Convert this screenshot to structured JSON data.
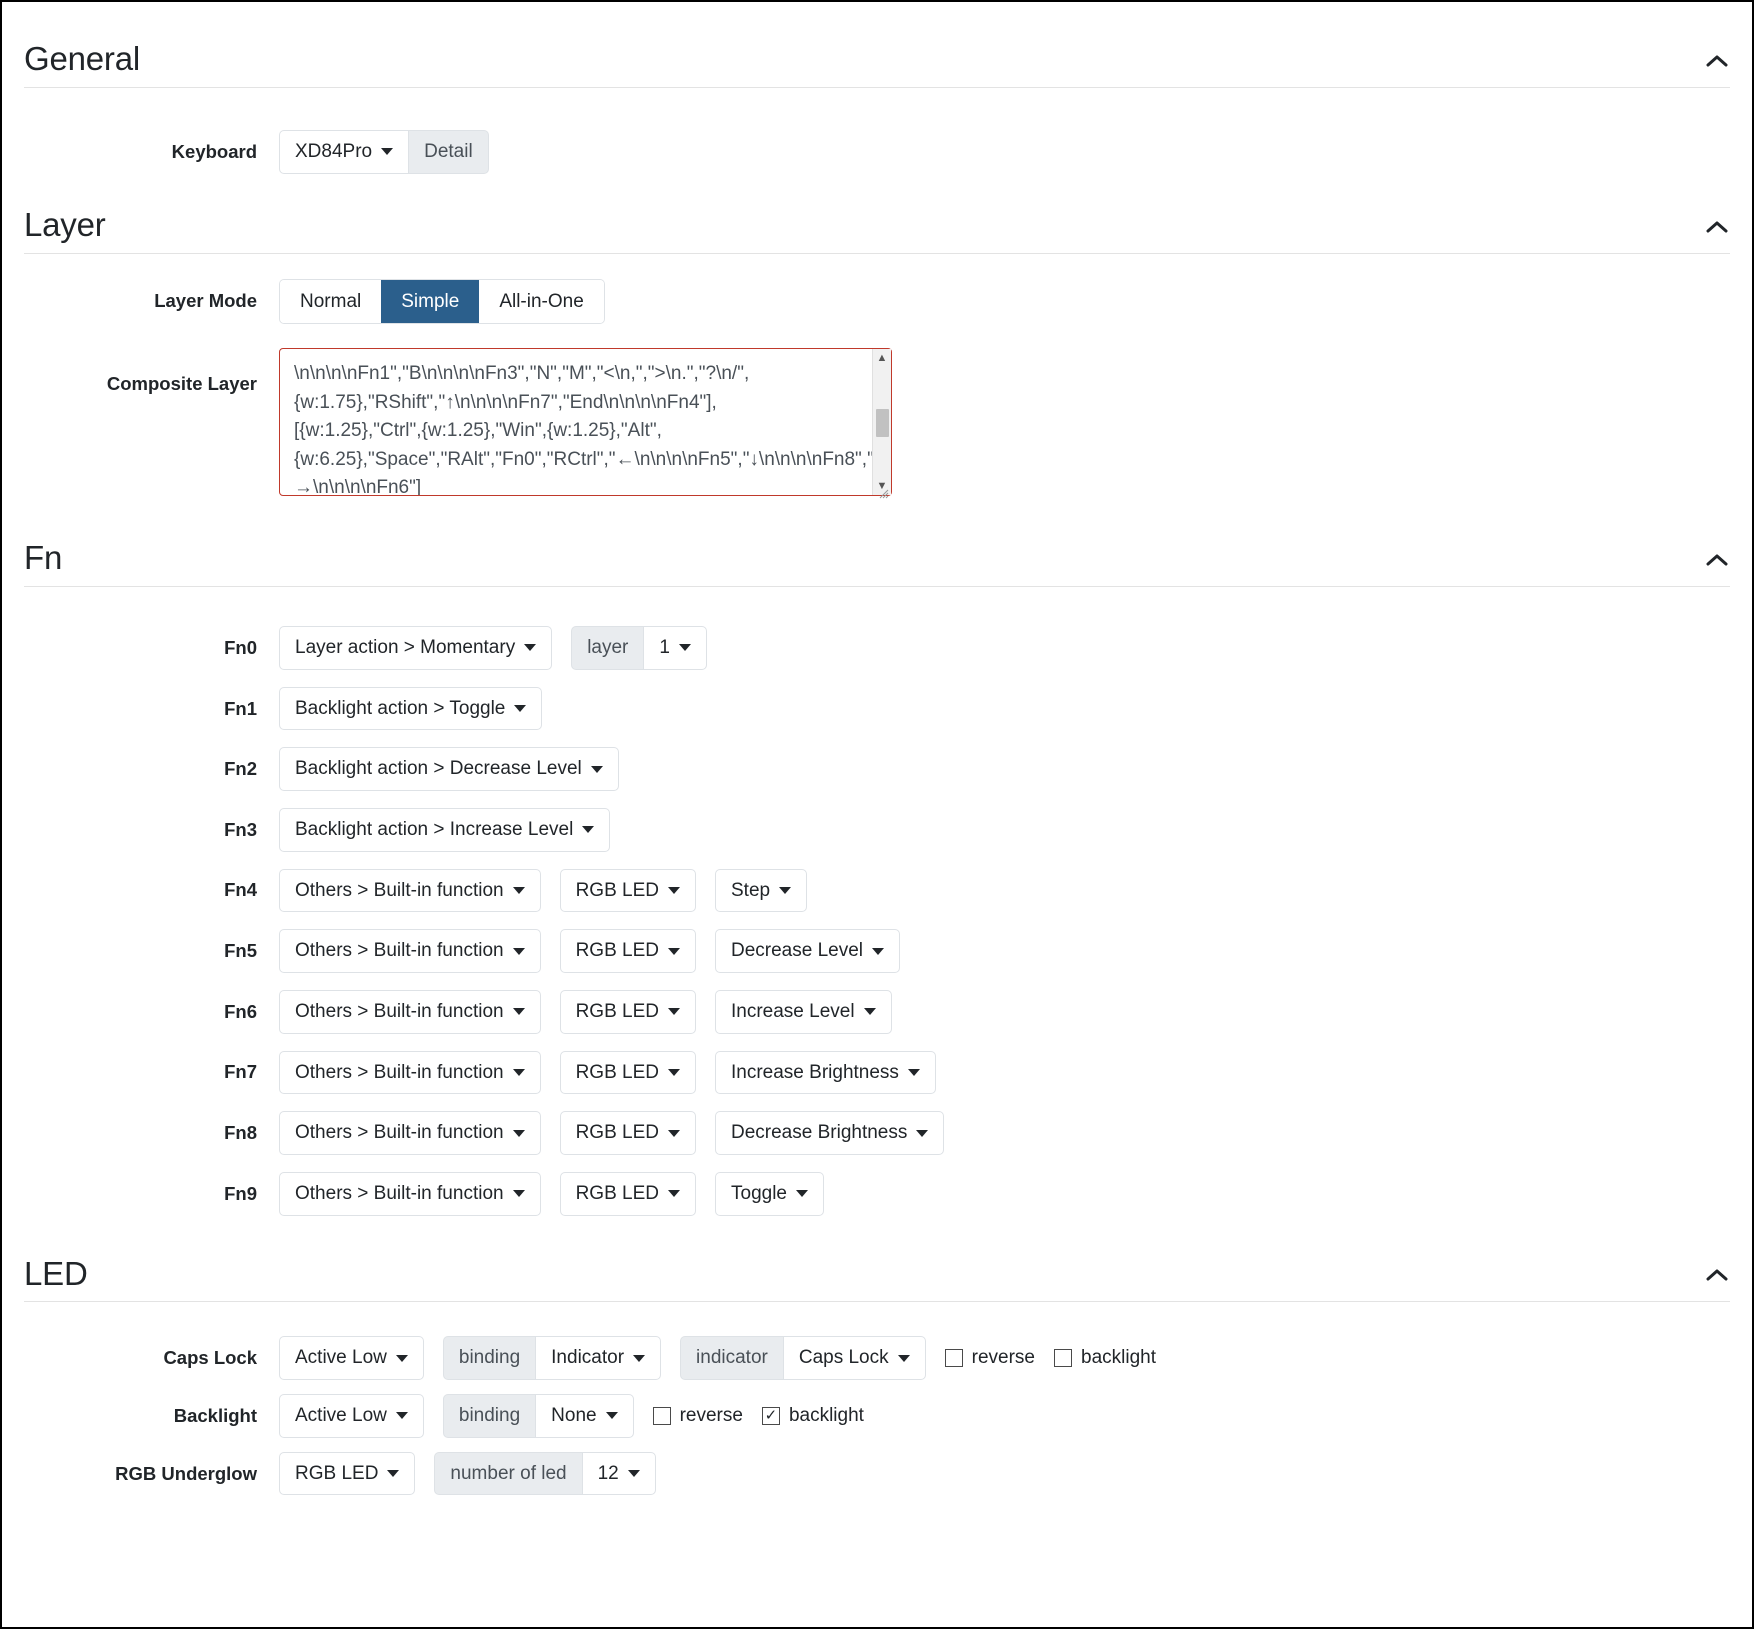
{
  "sections": [
    {
      "id": "general",
      "title": "General",
      "collapse_icon": "chevron-up-icon"
    },
    {
      "id": "layer",
      "title": "Layer",
      "collapse_icon": "chevron-up-icon"
    },
    {
      "id": "fn",
      "title": "Fn",
      "collapse_icon": "chevron-up-icon"
    },
    {
      "id": "led",
      "title": "LED",
      "collapse_icon": "chevron-up-icon"
    }
  ],
  "general": {
    "keyboard_label": "Keyboard",
    "keyboard_value": "XD84Pro",
    "detail_label": "Detail"
  },
  "layer": {
    "layer_mode_label": "Layer Mode",
    "modes": [
      {
        "label": "Normal",
        "active": false
      },
      {
        "label": "Simple",
        "active": true
      },
      {
        "label": "All-in-One",
        "active": false
      }
    ],
    "active_mode_color": "#2b5f8c",
    "composite_layer_label": "Composite Layer",
    "composite_layer_value": "\\n\\n\\n\\nFn1\",\"B\\n\\n\\n\\nFn3\",\"N\",\"M\",\"<\\n,\",\">\\n.\",\"?\\n/\",{w:1.75},\"RShift\",\"↑\\n\\n\\n\\nFn7\",\"End\\n\\n\\n\\nFn4\"],\n[{w:1.25},\"Ctrl\",{w:1.25},\"Win\",{w:1.25},\"Alt\",{w:6.25},\"Space\",\"RAlt\",\"Fn0\",\"RCtrl\",\"←\\n\\n\\n\\nFn5\",\"↓\\n\\n\\n\\nFn8\",\"→\\n\\n\\n\\nFn6\"]",
    "composite_layer_border_color": "#c0392b"
  },
  "fn": {
    "rows": [
      {
        "label": "Fn0",
        "action": "Layer action > Momentary",
        "group_addon": "layer",
        "group_value": "1"
      },
      {
        "label": "Fn1",
        "action": "Backlight action > Toggle"
      },
      {
        "label": "Fn2",
        "action": "Backlight action > Decrease Level"
      },
      {
        "label": "Fn3",
        "action": "Backlight action > Increase Level"
      },
      {
        "label": "Fn4",
        "action": "Others > Built-in function",
        "target": "RGB LED",
        "option": "Step"
      },
      {
        "label": "Fn5",
        "action": "Others > Built-in function",
        "target": "RGB LED",
        "option": "Decrease Level"
      },
      {
        "label": "Fn6",
        "action": "Others > Built-in function",
        "target": "RGB LED",
        "option": "Increase Level"
      },
      {
        "label": "Fn7",
        "action": "Others > Built-in function",
        "target": "RGB LED",
        "option": "Increase Brightness"
      },
      {
        "label": "Fn8",
        "action": "Others > Built-in function",
        "target": "RGB LED",
        "option": "Decrease Brightness"
      },
      {
        "label": "Fn9",
        "action": "Others > Built-in function",
        "target": "RGB LED",
        "option": "Toggle"
      }
    ]
  },
  "led": {
    "caps_lock": {
      "label": "Caps Lock",
      "polarity": "Active Low",
      "binding_addon": "binding",
      "binding_value": "Indicator",
      "indicator_addon": "indicator",
      "indicator_value": "Caps Lock",
      "reverse_label": "reverse",
      "reverse_checked": false,
      "backlight_label": "backlight",
      "backlight_checked": false
    },
    "backlight": {
      "label": "Backlight",
      "polarity": "Active Low",
      "binding_addon": "binding",
      "binding_value": "None",
      "reverse_label": "reverse",
      "reverse_checked": false,
      "backlight_label": "backlight",
      "backlight_checked": true
    },
    "rgb_underglow": {
      "label": "RGB Underglow",
      "type_value": "RGB LED",
      "count_addon": "number of led",
      "count_value": "12"
    }
  },
  "glyphs": {
    "checkmark": "☑",
    "empty": ""
  }
}
